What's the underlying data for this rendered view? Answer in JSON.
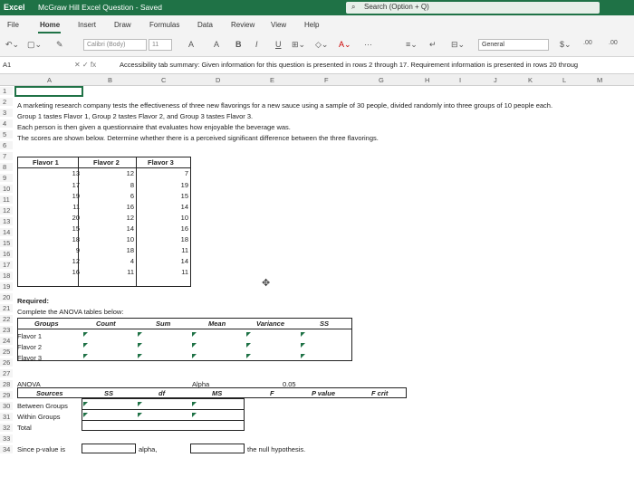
{
  "titlebar": {
    "app": "Excel",
    "doc": "McGraw Hill Excel Question - Saved",
    "search": "Search (Option + Q)"
  },
  "menu": [
    "File",
    "Home",
    "Insert",
    "Draw",
    "Formulas",
    "Data",
    "Review",
    "View",
    "Help"
  ],
  "ribbon": {
    "font_name": "Calibri (Body)",
    "font_size": "11",
    "number_format": "General"
  },
  "formula_bar": {
    "name_box": "A1",
    "formula": "Accessibility tab summary: Given information for this question is presented in rows 2 through 17. Requirement information is presented in rows 20 throug"
  },
  "columns": [
    "A",
    "B",
    "C",
    "D",
    "E",
    "F",
    "G",
    "H",
    "I",
    "J",
    "K",
    "L",
    "M"
  ],
  "rows": [
    "1",
    "2",
    "3",
    "4",
    "5",
    "6",
    "7",
    "8",
    "9",
    "10",
    "11",
    "12",
    "13",
    "14",
    "15",
    "16",
    "17",
    "18",
    "19",
    "20",
    "21",
    "22",
    "23",
    "24",
    "25",
    "26",
    "27",
    "28",
    "29",
    "30",
    "31",
    "32",
    "33",
    "34"
  ],
  "intro": [
    "A marketing research company tests the effectiveness of three new flavorings for a new sauce using a sample of 30 people, divided randomly into three groups of 10 people each.",
    "Group 1 tastes Flavor 1, Group 2 tastes Flavor 2, and Group 3 tastes Flavor 3.",
    "Each person is then given a questionnaire that evaluates how enjoyable the beverage was.",
    "The scores are shown below. Determine whether there is a perceived significant difference between the three flavorings."
  ],
  "flavors": {
    "headers": [
      "Flavor 1",
      "Flavor 2",
      "Flavor 3"
    ],
    "rows": [
      [
        "13",
        "12",
        "7"
      ],
      [
        "17",
        "8",
        "19"
      ],
      [
        "19",
        "6",
        "15"
      ],
      [
        "11",
        "16",
        "14"
      ],
      [
        "20",
        "12",
        "10"
      ],
      [
        "15",
        "14",
        "16"
      ],
      [
        "18",
        "10",
        "18"
      ],
      [
        "9",
        "18",
        "11"
      ],
      [
        "12",
        "4",
        "14"
      ],
      [
        "16",
        "11",
        "11"
      ]
    ]
  },
  "required": {
    "heading": "Required:",
    "instruction": "Complete the ANOVA tables below:"
  },
  "summary_table": {
    "headers": [
      "Groups",
      "Count",
      "Sum",
      "Mean",
      "Variance",
      "SS"
    ],
    "rows": [
      "Flavor 1",
      "Flavor 2",
      "Flavor 3"
    ]
  },
  "anova": {
    "label": "ANOVA",
    "alpha_label": "Alpha",
    "alpha_value": "0.05",
    "headers": [
      "Sources",
      "SS",
      "df",
      "MS",
      "F",
      "P value",
      "F crit"
    ],
    "rows": [
      "Between Groups",
      "Within Groups",
      "Total"
    ]
  },
  "conclusion": {
    "p_prefix": "Since p-value is",
    "alpha": "alpha,",
    "null": "the null hypothesis."
  }
}
